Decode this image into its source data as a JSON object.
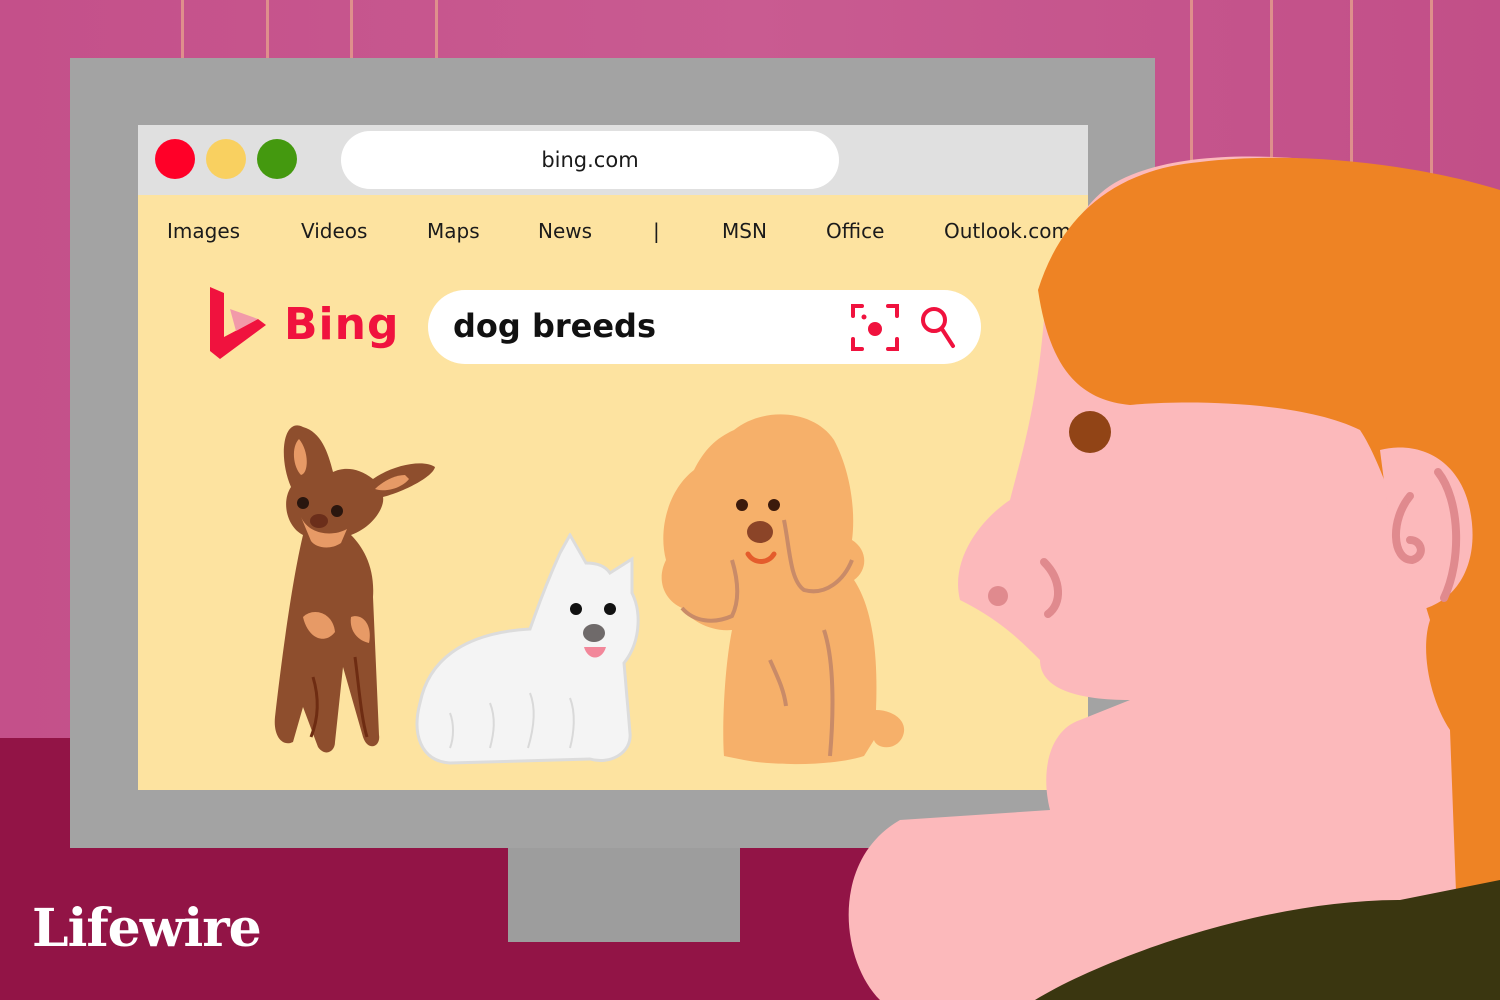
{
  "illustration": {
    "credit": "Lifewire"
  },
  "browser": {
    "window_controls": [
      {
        "name": "close",
        "color": "#ff0028"
      },
      {
        "name": "minimize",
        "color": "#f9d060"
      },
      {
        "name": "maximize",
        "color": "#44990f"
      }
    ],
    "address_bar": {
      "url": "bing.com"
    }
  },
  "page": {
    "nav": {
      "items": [
        "Images",
        "Videos",
        "Maps",
        "News",
        "|",
        "MSN",
        "Office",
        "Outlook.com"
      ]
    },
    "logo": {
      "text": "Bing",
      "color": "#f0123e"
    },
    "search": {
      "query": "dog breeds",
      "visual_search_icon": "camera-scan-icon",
      "search_icon": "magnifier-icon"
    },
    "results_images": [
      {
        "breed_depicted": "miniature pinscher"
      },
      {
        "breed_depicted": "west highland white terrier"
      },
      {
        "breed_depicted": "toy poodle"
      }
    ]
  },
  "colors": {
    "wall": "#c9568c",
    "floor": "#921446",
    "monitor": "#a3a3a3",
    "screen_bg": "#fde3a0",
    "hair": "#ee8324",
    "skin": "#fcb9bb"
  }
}
